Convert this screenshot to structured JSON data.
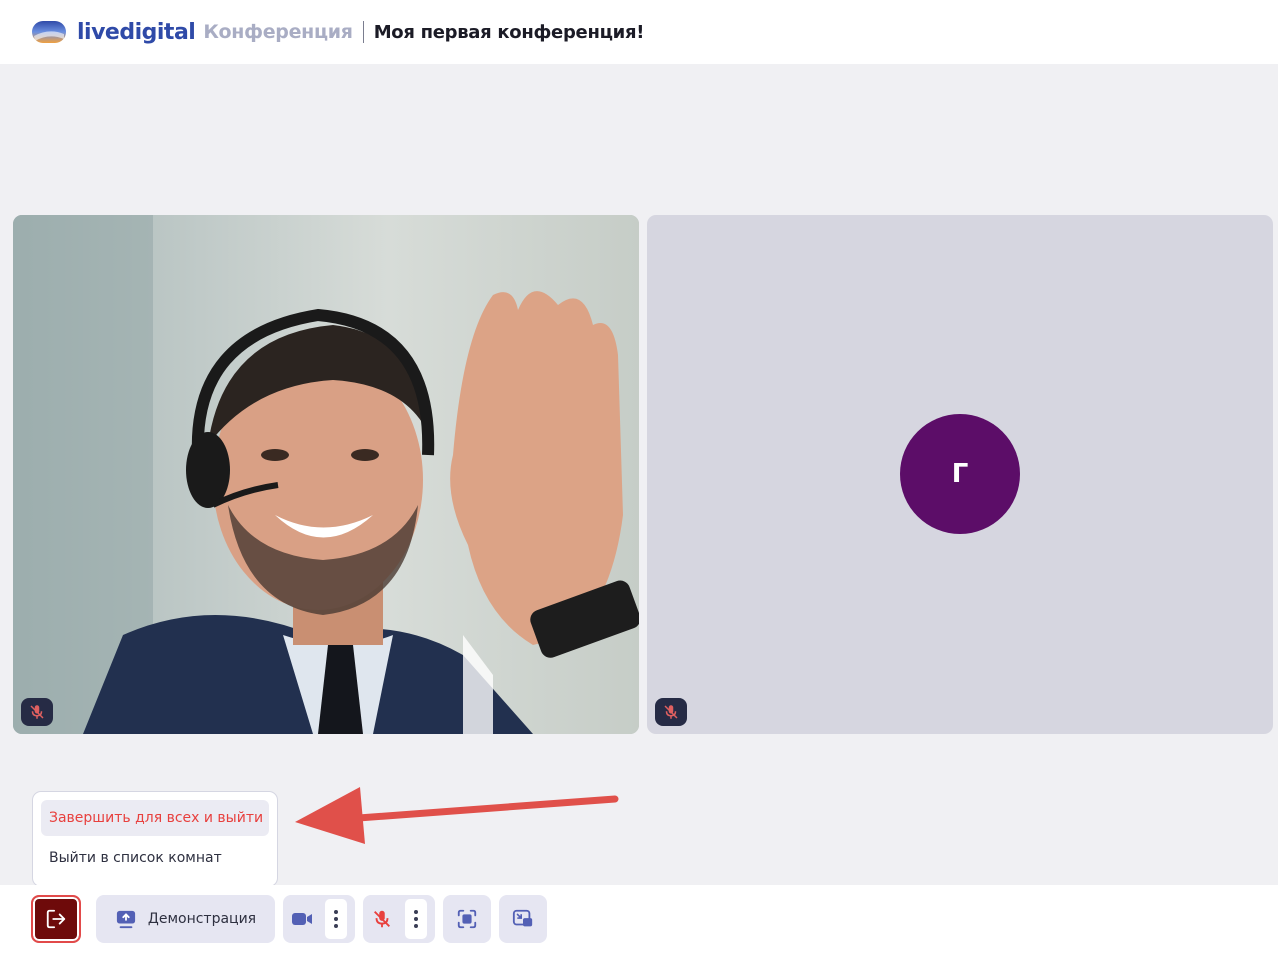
{
  "header": {
    "logo_text": "livedigital",
    "section": "Конференция",
    "conference_title": "Моя первая конференция!"
  },
  "participants": [
    {
      "type": "video",
      "mic": "muted",
      "mic_icon": "mic-off-icon"
    },
    {
      "type": "avatar",
      "initial": "Г",
      "avatar_color": "#5c0d68",
      "mic": "muted",
      "mic_icon": "mic-off-icon"
    }
  ],
  "exit_menu": {
    "end_for_all": "Завершить для всех и выйти",
    "leave_to_rooms": "Выйти в список комнат"
  },
  "toolbar": {
    "leave_icon": "leave-icon",
    "demo_label": "Демонстрация",
    "demo_icon": "screen-share-icon",
    "camera_icon": "camera-icon",
    "mic_icon": "mic-off-icon",
    "more_icon": "more-vertical-icon",
    "layout_icon": "layout-focus-icon",
    "pip_icon": "picture-in-picture-icon"
  },
  "colors": {
    "brand": "#2f4aa8",
    "danger": "#e8403e",
    "leave_button": "#6e0a0a",
    "button_bg": "#e6e6f2",
    "page_bg": "#f0f0f3"
  }
}
